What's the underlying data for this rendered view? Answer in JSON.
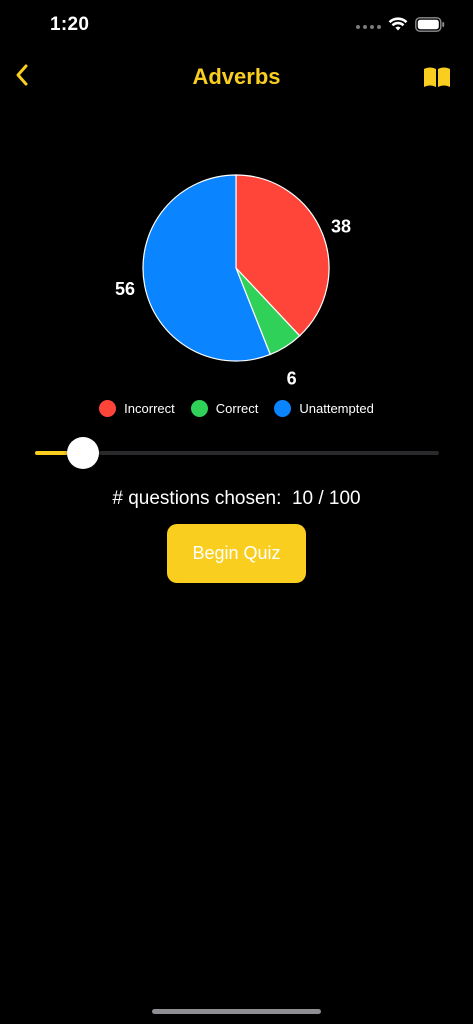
{
  "status_bar": {
    "time": "1:20"
  },
  "nav": {
    "title": "Adverbs",
    "back_icon": "chevron-left-icon",
    "book_icon": "book-icon"
  },
  "colors": {
    "accent": "#F9CE1F",
    "incorrect": "#FF453A",
    "correct": "#30D158",
    "unattempted": "#0A84FF",
    "background": "#000000"
  },
  "chart_data": {
    "type": "pie",
    "slices": [
      {
        "label": "Incorrect",
        "value": 38,
        "color": "#FF453A"
      },
      {
        "label": "Correct",
        "value": 6,
        "color": "#30D158"
      },
      {
        "label": "Unattempted",
        "value": 56,
        "color": "#0A84FF"
      }
    ],
    "data_labels": [
      "38",
      "6",
      "56"
    ],
    "legend": [
      "Incorrect",
      "Correct",
      "Unattempted"
    ],
    "legend_position": "bottom"
  },
  "legend": {
    "incorrect": "Incorrect",
    "correct": "Correct",
    "unattempted": "Unattempted"
  },
  "slider": {
    "value": 10,
    "max": 100,
    "fraction": 0.1
  },
  "question_count": {
    "label": "# questions chosen:",
    "value": "10 / 100",
    "display": "# questions chosen:  10 / 100"
  },
  "begin_button": {
    "label": "Begin Quiz"
  }
}
